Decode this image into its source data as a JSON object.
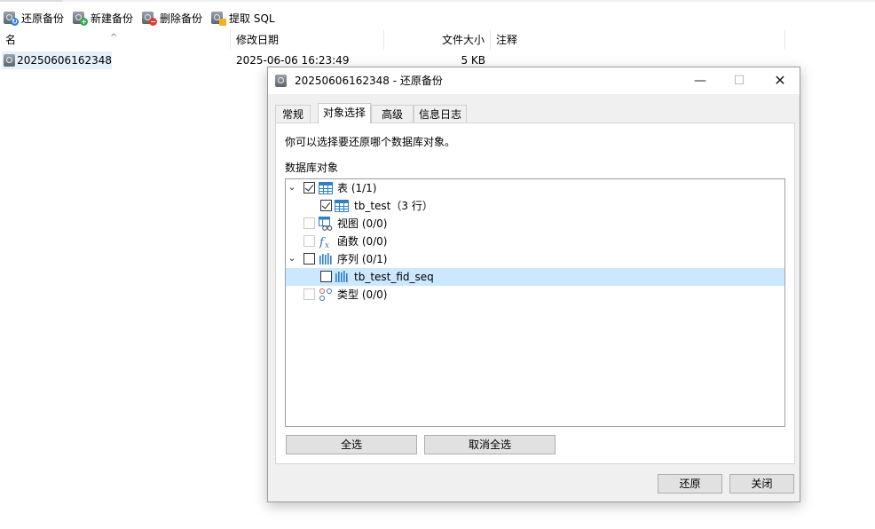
{
  "toolbar": {
    "restore_label": "还原备份",
    "new_label": "新建备份",
    "delete_label": "删除备份",
    "extract_label": "提取 SQL"
  },
  "list": {
    "columns": {
      "name": "名",
      "modified": "修改日期",
      "size": "文件大小",
      "comment": "注释"
    },
    "rows": [
      {
        "name": "20250606162348",
        "modified": "2025-06-06 16:23:49",
        "size": "5 KB",
        "comment": ""
      }
    ]
  },
  "dialog": {
    "title": "20250606162348 - 还原备份",
    "window_buttons": {
      "minimize": "—",
      "maximize": "☐",
      "close": "✕"
    },
    "tabs": [
      "常规",
      "对象选择",
      "高级",
      "信息日志"
    ],
    "active_tab": "对象选择",
    "description": "你可以选择要还原哪个数据库对象。",
    "tree_label": "数据库对象",
    "tree": [
      {
        "label": "表 (1/1)",
        "level": 0,
        "expanded": true,
        "checked": true,
        "enabled": true,
        "icon": "table-icon"
      },
      {
        "label": "tb_test（3 行）",
        "level": 1,
        "checked": true,
        "enabled": true,
        "icon": "table-icon"
      },
      {
        "label": "视图 (0/0)",
        "level": 0,
        "checked": false,
        "enabled": false,
        "icon": "view-icon"
      },
      {
        "label": "函数 (0/0)",
        "level": 0,
        "checked": false,
        "enabled": false,
        "icon": "function-icon"
      },
      {
        "label": "序列 (0/1)",
        "level": 0,
        "expanded": true,
        "checked": false,
        "enabled": true,
        "icon": "sequence-icon"
      },
      {
        "label": "tb_test_fid_seq",
        "level": 1,
        "checked": false,
        "enabled": true,
        "icon": "sequence-icon",
        "selected": true
      },
      {
        "label": "类型 (0/0)",
        "level": 0,
        "checked": false,
        "enabled": false,
        "icon": "type-icon"
      }
    ],
    "select_all_label": "全选",
    "deselect_all_label": "取消全选",
    "restore_label": "还原",
    "close_label": "关闭"
  }
}
